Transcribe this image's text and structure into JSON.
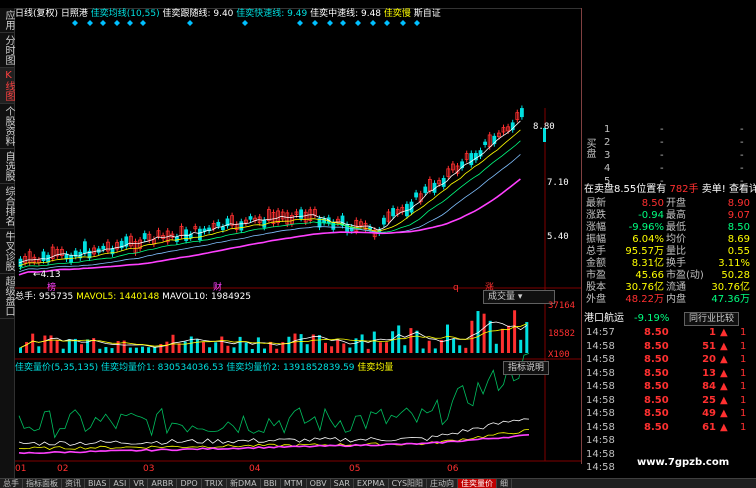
{
  "sidebar": {
    "tabs": [
      {
        "label": "应用",
        "active": false
      },
      {
        "label": "分时图",
        "active": false
      },
      {
        "label": "K线图",
        "active": true
      },
      {
        "label": "个股资料",
        "active": false
      },
      {
        "label": "自选股",
        "active": false
      },
      {
        "label": "综合排名",
        "active": false
      },
      {
        "label": "牛叉诊股",
        "active": false
      },
      {
        "label": "超级盘口",
        "active": false
      }
    ]
  },
  "chart_header": {
    "period": "日线(复权)",
    "stock_name": "日照港",
    "ind1": "佳奕均线(10,55)",
    "ind2": "佳奕跟随线: 9.40",
    "ind3": "佳奕快速线: 9.49",
    "ind4": "佳奕中速线: 9.48",
    "ind5": "佳奕慢",
    "ind6": "斯自证"
  },
  "price_axis": {
    "labels": [
      "8.80",
      "7.10",
      "5.40"
    ]
  },
  "annotations": {
    "low_price": "4.13",
    "tag1": "榜",
    "tag2": "财",
    "tag3": "q",
    "tag4": "涨"
  },
  "volume_panel": {
    "header_total": "总手: 955735",
    "header_mavol5": "MAVOL5: 1440148",
    "header_mavol10": "MAVOL10: 1984925",
    "dropdown": "成交量",
    "axis": [
      "37164",
      "18582",
      "X100"
    ]
  },
  "indicator_panel": {
    "header_price": "佳奕量价(5,35,135)",
    "header_v1": "佳奕均量价1: 830534036.53",
    "header_v2": "佳奕均量价2: 1391852839.59",
    "header_v3": "佳奕均量",
    "explain_btn": "指标说明"
  },
  "date_axis": [
    "01",
    "02",
    "03",
    "04",
    "05",
    "06"
  ],
  "orderbook": {
    "buy_label": "买盘",
    "rows": [
      {
        "n": "1",
        "p": "-",
        "v": "-"
      },
      {
        "n": "2",
        "p": "-",
        "v": "-"
      },
      {
        "n": "3",
        "p": "-",
        "v": "-"
      },
      {
        "n": "4",
        "p": "-",
        "v": "-"
      },
      {
        "n": "5",
        "p": "-",
        "v": "-"
      }
    ],
    "sell_text": "在卖盘8.55位置有",
    "sell_hands": "782手",
    "sell_action": "卖单!",
    "detail_link": "查看详细"
  },
  "stats": [
    {
      "l": "最新",
      "v": "8.50",
      "vc": "red",
      "l2": "开盘",
      "v2": "8.90",
      "v2c": "red"
    },
    {
      "l": "涨跌",
      "v": "-0.94",
      "vc": "grn",
      "l2": "最高",
      "v2": "9.07",
      "v2c": "red"
    },
    {
      "l": "涨幅",
      "v": "-9.96%",
      "vc": "grn",
      "l2": "最低",
      "v2": "8.50",
      "v2c": "grn"
    },
    {
      "l": "振幅",
      "v": "6.04%",
      "vc": "yel",
      "l2": "均价",
      "v2": "8.69",
      "v2c": "yel"
    },
    {
      "l": "总手",
      "v": "95.57万",
      "vc": "yel",
      "l2": "量比",
      "v2": "0.55",
      "v2c": "yel"
    },
    {
      "l": "金额",
      "v": "8.31亿",
      "vc": "yel",
      "l2": "换手",
      "v2": "3.11%",
      "v2c": "yel"
    },
    {
      "l": "市盈",
      "v": "45.66",
      "vc": "yel",
      "l2": "市盈(动)",
      "v2": "50.28",
      "v2c": "yel"
    },
    {
      "l": "股本",
      "v": "30.76亿",
      "vc": "yel",
      "l2": "流通",
      "v2": "30.76亿",
      "v2c": "yel"
    },
    {
      "l": "外盘",
      "v": "48.22万",
      "vc": "red",
      "l2": "内盘",
      "v2": "47.36万",
      "v2c": "grn"
    }
  ],
  "sector": {
    "name": "港口航运",
    "pct": "-9.19%",
    "btn": "同行业比较"
  },
  "ticks": [
    {
      "t": "14:57",
      "p": "8.50",
      "v": "1",
      "n": "1"
    },
    {
      "t": "14:58",
      "p": "8.50",
      "v": "51",
      "n": "1"
    },
    {
      "t": "14:58",
      "p": "8.50",
      "v": "20",
      "n": "1"
    },
    {
      "t": "14:58",
      "p": "8.50",
      "v": "13",
      "n": "1"
    },
    {
      "t": "14:58",
      "p": "8.50",
      "v": "84",
      "n": "1"
    },
    {
      "t": "14:58",
      "p": "8.50",
      "v": "25",
      "n": "1"
    },
    {
      "t": "14:58",
      "p": "8.50",
      "v": "49",
      "n": "1"
    },
    {
      "t": "14:58",
      "p": "8.50",
      "v": "61",
      "n": "1"
    },
    {
      "t": "14:58",
      "p": "",
      "v": "",
      "n": ""
    },
    {
      "t": "14:58",
      "p": "",
      "v": "",
      "n": ""
    },
    {
      "t": "14:58",
      "p": "",
      "v": "",
      "n": ""
    }
  ],
  "bottom_tabs": [
    "总手",
    "指标面板",
    "资讯",
    "BIAS",
    "ASI",
    "VR",
    "ARBR",
    "DPO",
    "TRIX",
    "新DMA",
    "BBI",
    "MTM",
    "OBV",
    "SAR",
    "EXPMA",
    "CYS阳阳",
    "庄动向",
    "佳奕量价",
    "细"
  ],
  "bottom_active": "佳奕量价",
  "watermark": "www.7gpzb.com",
  "colors": {
    "up": "#ff3030",
    "down": "#00e0e0",
    "accent": "#ffff00",
    "ma_magenta": "#ff40ff"
  }
}
